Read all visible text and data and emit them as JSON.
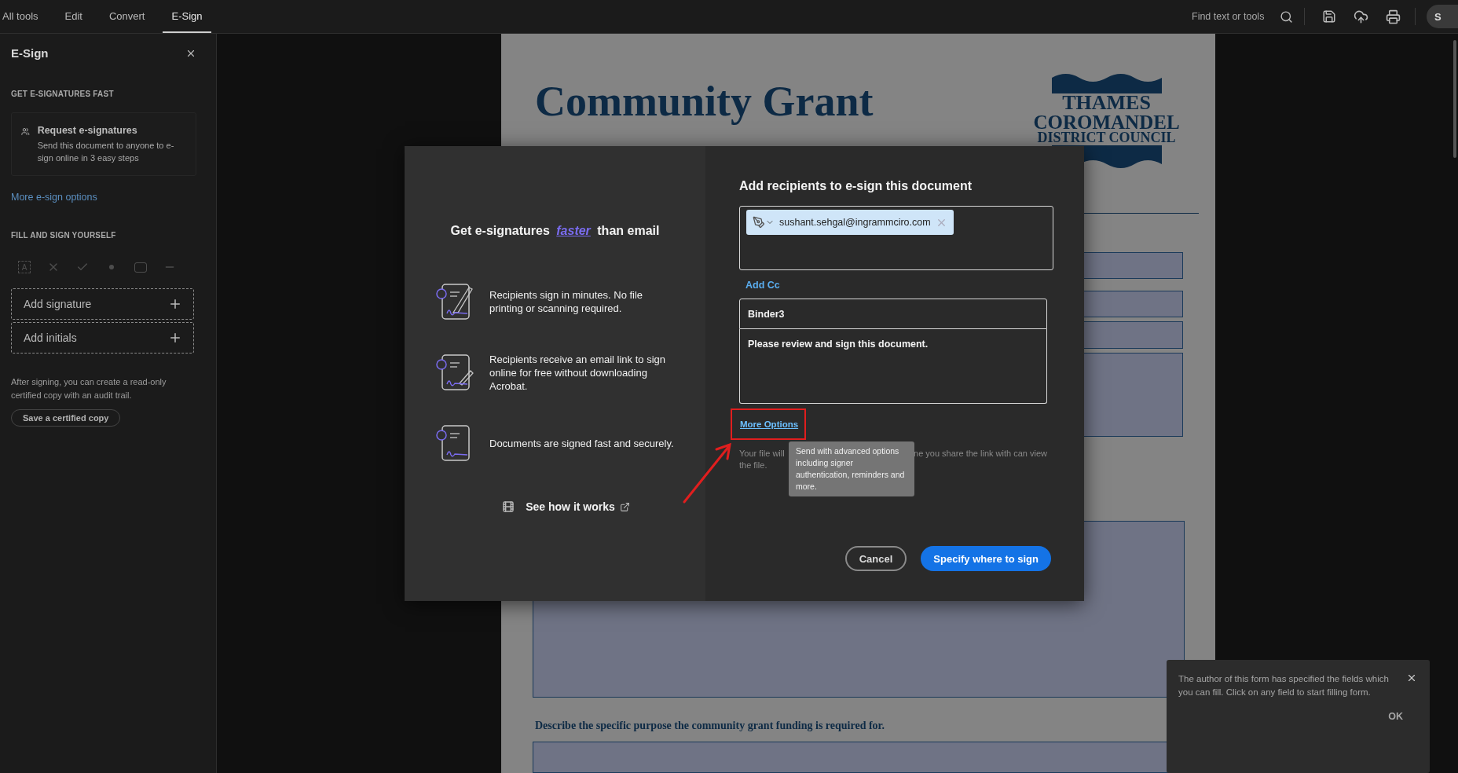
{
  "toolbar": {
    "tabs": [
      {
        "label": "All tools",
        "selected": false
      },
      {
        "label": "Edit",
        "selected": false
      },
      {
        "label": "Convert",
        "selected": false
      },
      {
        "label": "E-Sign",
        "selected": true
      }
    ],
    "search": {
      "placeholder": "Find text or tools"
    },
    "share_button": {
      "label": "S"
    }
  },
  "sidebar": {
    "title": "E-Sign",
    "request_section": {
      "heading": "GET E-SIGNATURES FAST",
      "card_title": "Request e-signatures",
      "card_text": "Send this document to anyone to e-sign online in 3 easy steps",
      "link": "More e-sign options"
    },
    "fill_section": {
      "heading": "FILL AND SIGN YOURSELF",
      "tools_disabled": true,
      "text_tool_glyph": "A",
      "actions": [
        "Add signature",
        "Add initials"
      ],
      "note": "After signing, you can create a read-only certified copy with an audit trail.",
      "button": "Save a certified copy"
    }
  },
  "document": {
    "title": "Community Grant",
    "logo_lines": [
      "THAMES",
      "COROMANDEL",
      "DISTRICT COUNCIL"
    ],
    "question": "Describe the specific purpose the community grant funding is required for."
  },
  "dialog": {
    "promo": {
      "heading": "Get e-signatures *faster* than email",
      "features": [
        "Recipients sign in minutes. No file printing or scanning required.",
        "Recipients receive an email link to sign online for free without downloading Acrobat.",
        "Documents are signed fast and securely."
      ],
      "video_link": "See how it works"
    },
    "form": {
      "title": "Add recipients to e-sign this document",
      "recipients": [
        {
          "email": "sushant.sehgal@ingrammciro.com"
        }
      ],
      "cc_link": "Add Cc",
      "subject": "Binder3",
      "message": "Please review and sign this document.",
      "more_options": "More Options",
      "note_parts": [
        "Your file will",
        "ne you share the link with can view",
        "the file."
      ],
      "tooltip": "Send with advanced options including signer authentication, reminders and more.",
      "buttons": [
        {
          "label": "Cancel",
          "kind": "secondary"
        },
        {
          "label": "Specify where to sign",
          "kind": "primary"
        }
      ]
    }
  },
  "toast": {
    "message": "The author of this form has specified the fields which you can fill. Click on any field to start filling form.",
    "button": "OK"
  }
}
